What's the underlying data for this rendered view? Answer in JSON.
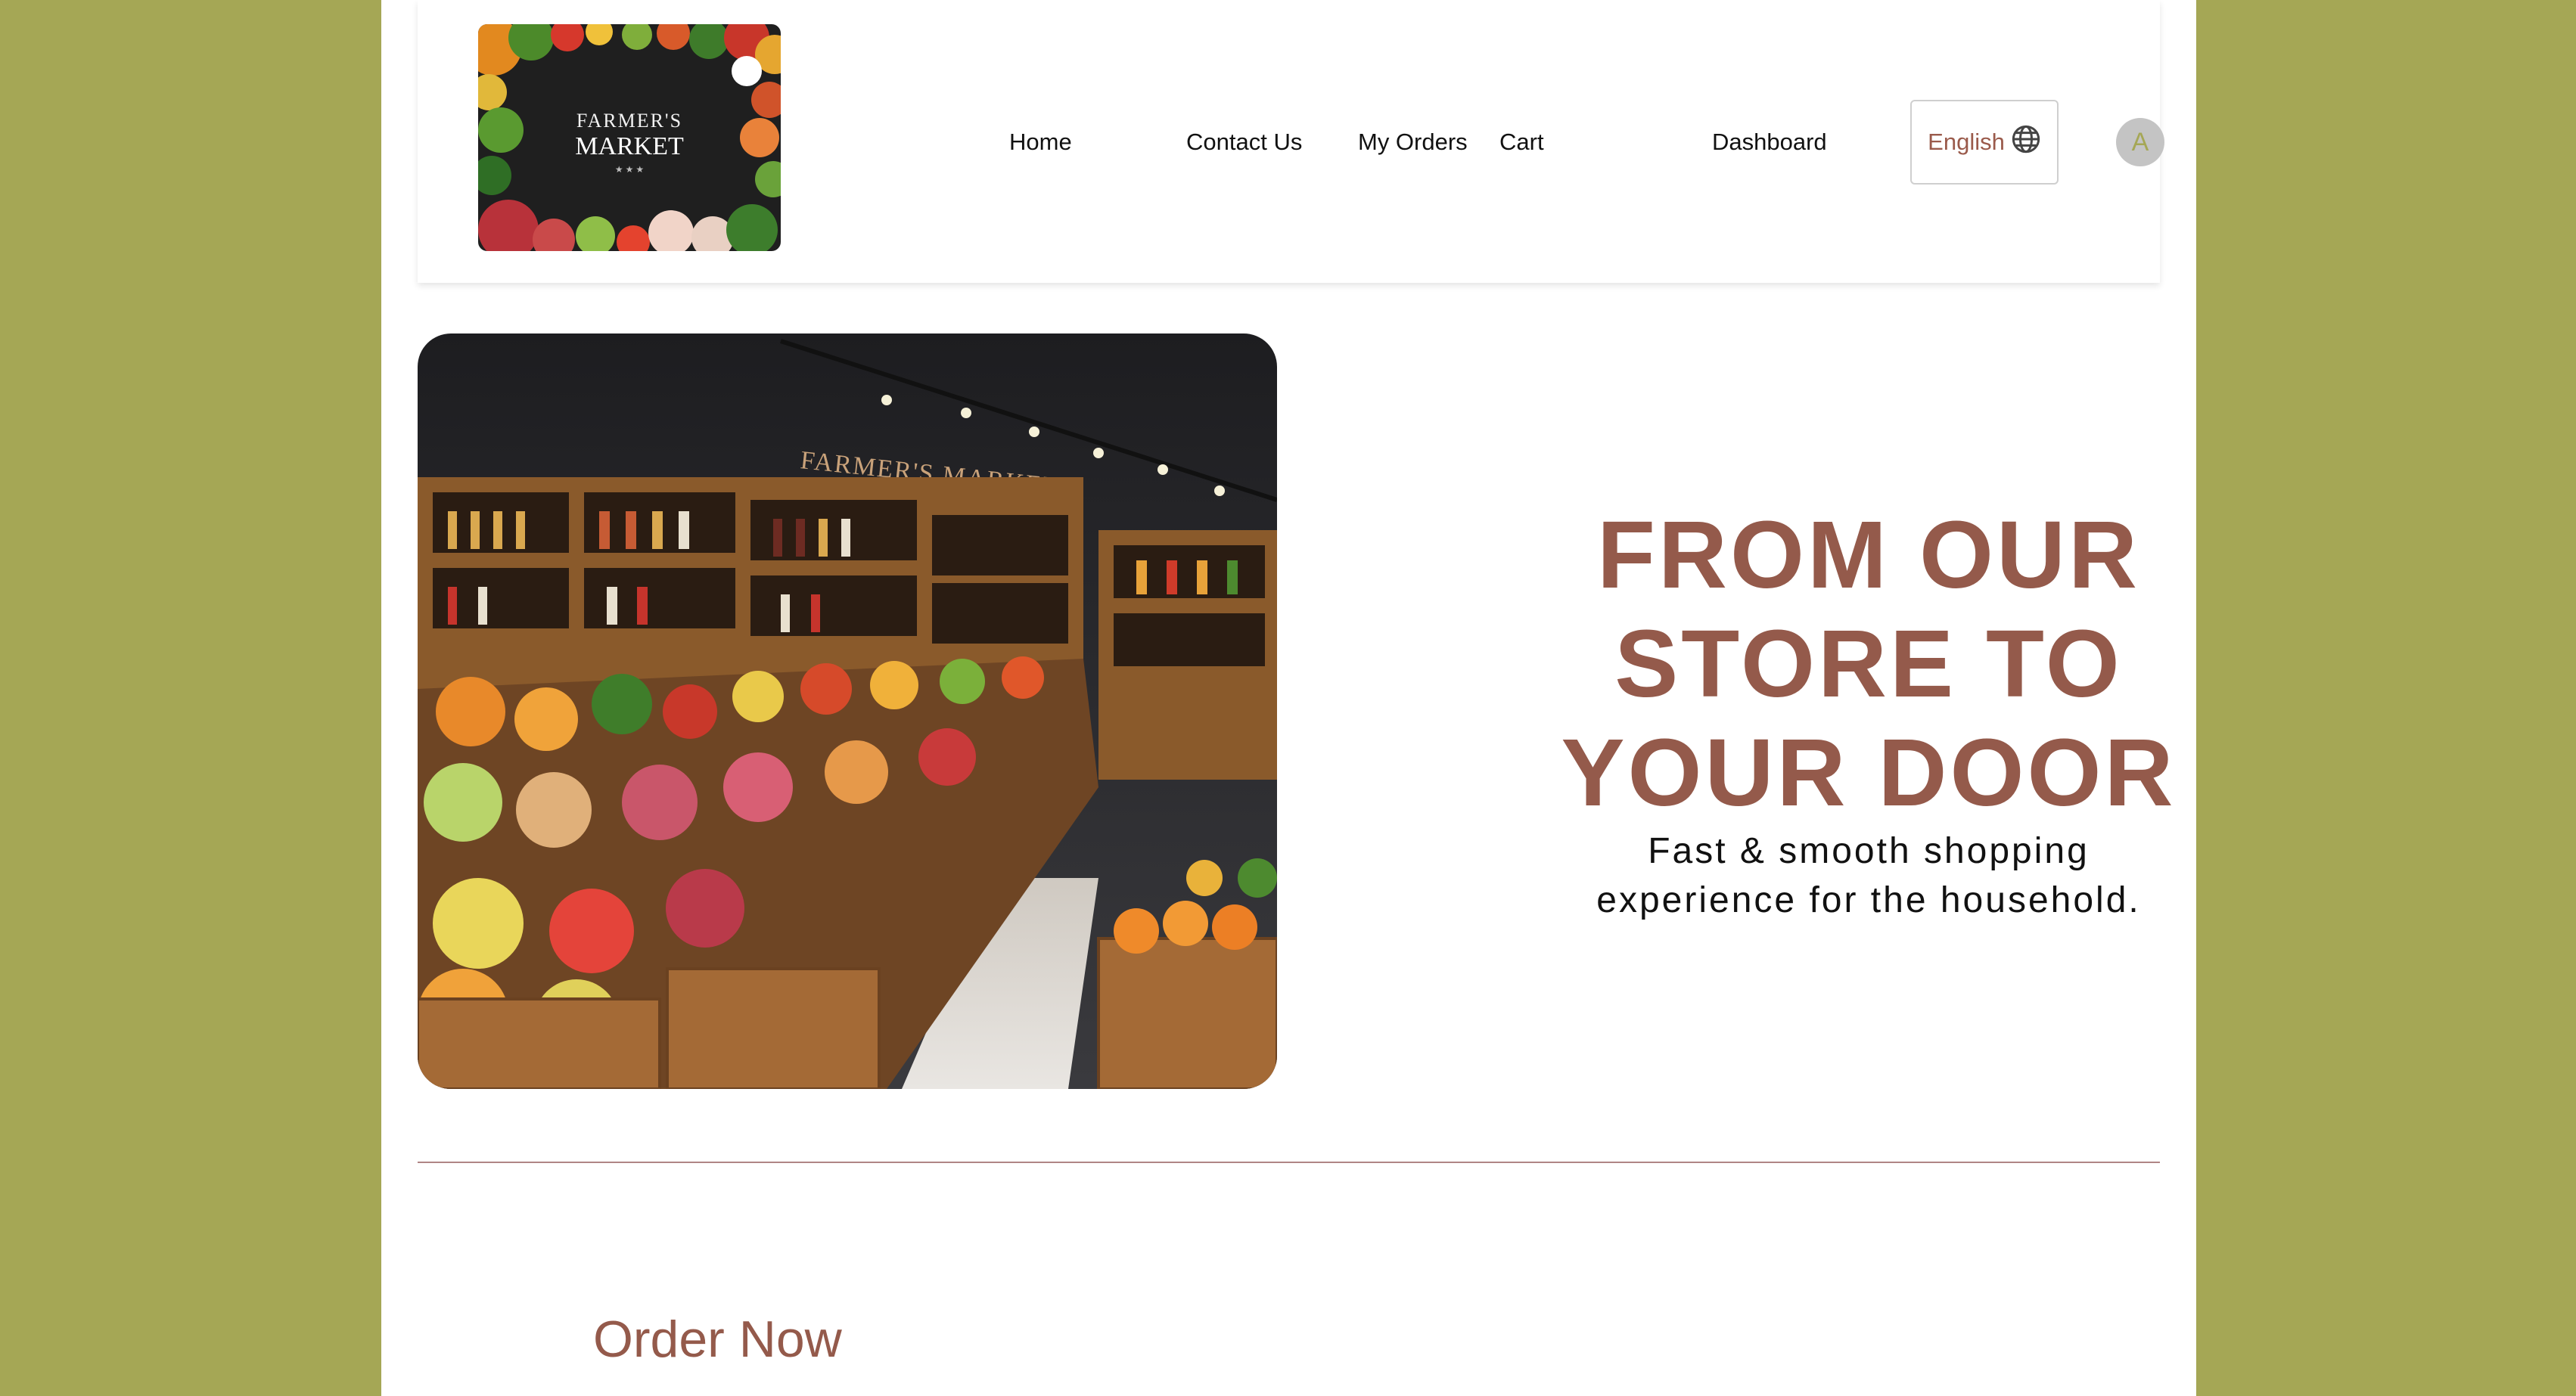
{
  "logo": {
    "top_text": "",
    "line1": "FARMER'S",
    "line2": "MARKET"
  },
  "nav": {
    "items": [
      {
        "label": "Home"
      },
      {
        "label": "Contact Us"
      },
      {
        "label": "My Orders"
      },
      {
        "label": "Cart"
      },
      {
        "label": "Dashboard"
      }
    ],
    "language": "English",
    "avatar_initial": "A"
  },
  "hero": {
    "store_sign": "FARMER'S MARKET",
    "title_lines": [
      "FROM OUR",
      "STORE TO",
      "YOUR DOOR"
    ],
    "subtitle_lines": [
      "Fast & smooth shopping",
      "experience for the household."
    ]
  },
  "cta": {
    "order_now": "Order Now"
  },
  "colors": {
    "page_background": "#a5a755",
    "accent": "#945a4b",
    "divider": "#b08585"
  },
  "icons": {
    "language": "globe-icon"
  }
}
